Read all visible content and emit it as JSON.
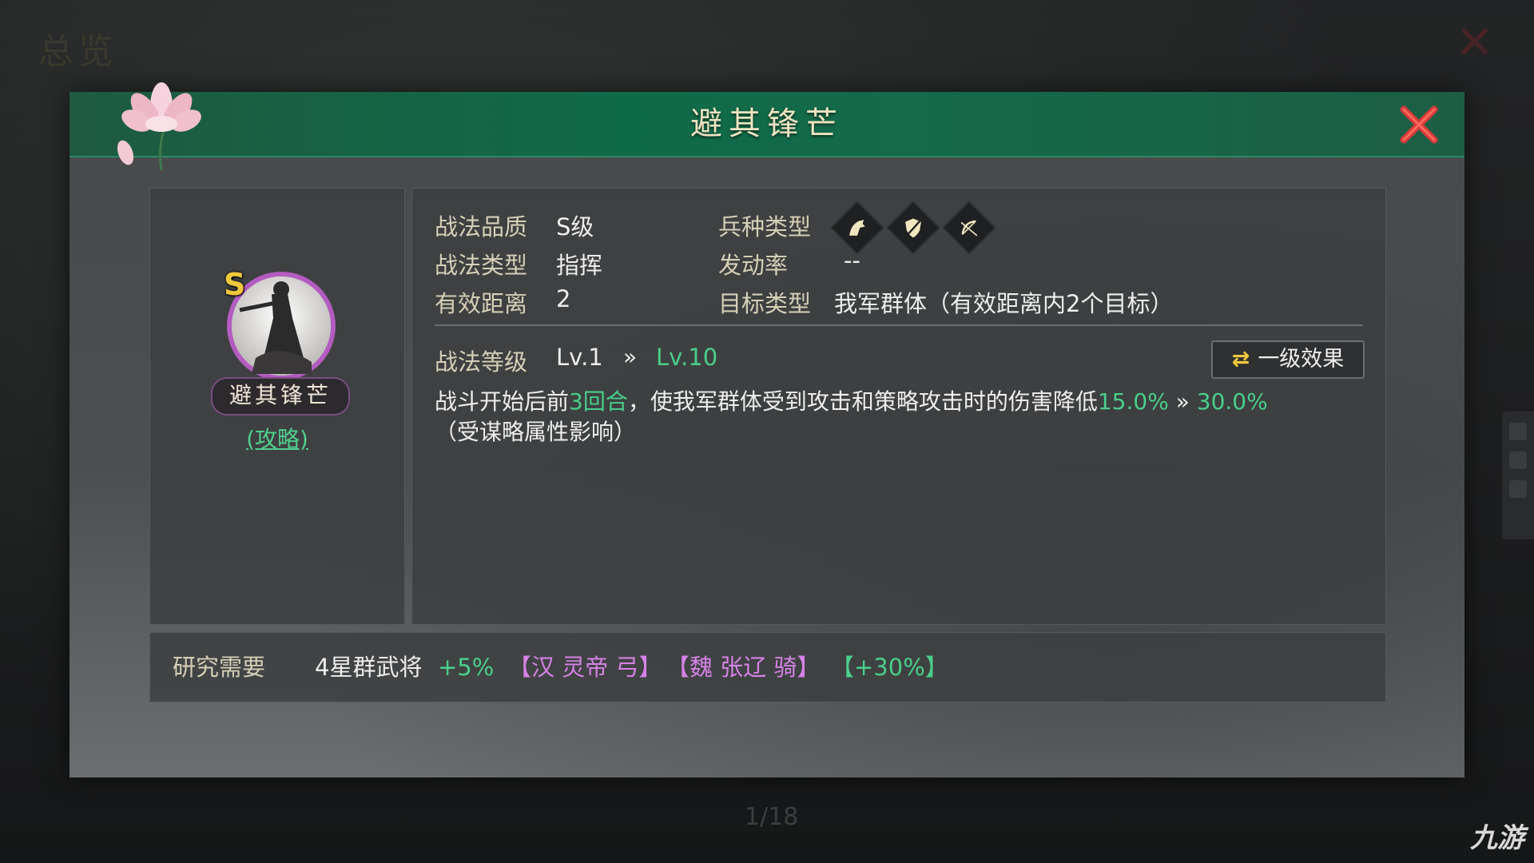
{
  "background": {
    "title": "总览",
    "page_number": "1/18",
    "watermark": "九游"
  },
  "dialog": {
    "title": "避其锋芒",
    "close_icon": "close-x-icon"
  },
  "skill": {
    "grade_badge": "S",
    "name": "避其锋芒",
    "strategy_link": "(攻略)"
  },
  "info": {
    "quality_label": "战法品质",
    "quality_value": "S级",
    "troop_label": "兵种类型",
    "troop_icons": [
      "cavalry-icon",
      "shield-icon",
      "archer-icon"
    ],
    "type_label": "战法类型",
    "type_value": "指挥",
    "rate_label": "发动率",
    "rate_value": "--",
    "range_label": "有效距离",
    "range_value": "2",
    "target_label": "目标类型",
    "target_value": "我军群体（有效距离内2个目标）"
  },
  "level": {
    "label": "战法等级",
    "from": "Lv.1",
    "arrow": "»",
    "to": "Lv.10",
    "effect_button": "一级效果"
  },
  "description": {
    "part1": "战斗开始后前",
    "rounds": "3回合",
    "part2": "，使我军群体受到攻击和策略攻击时的伤害降低",
    "value_from": "15.0%",
    "arrow": "»",
    "value_to": "30.0%",
    "note": "（受谋略属性影响）"
  },
  "research": {
    "label": "研究需要",
    "requirement": "4星群武将",
    "bonus": "+5%",
    "hero1": "【汉 灵帝 弓】",
    "hero2": "【魏 张辽 骑】",
    "bonus2": "【+30%】"
  },
  "colors": {
    "header_green": "#0f6a48",
    "value_green": "#49cf8a",
    "hero_purple": "#d682e6",
    "close_red": "#d63b3b",
    "grade_gold": "#f0c83c"
  }
}
